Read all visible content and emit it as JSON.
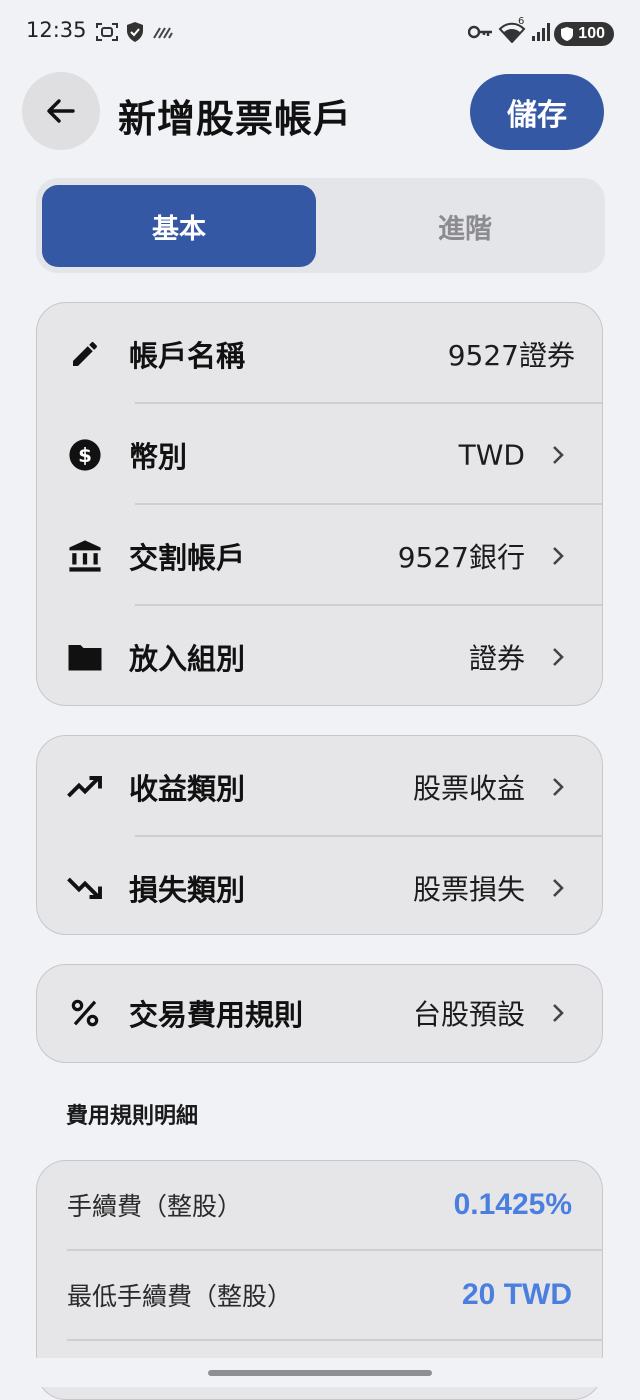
{
  "status_bar": {
    "time": "12:35",
    "battery": "100",
    "network_badge": "6"
  },
  "header": {
    "title": "新增股票帳戶",
    "save_label": "儲存"
  },
  "tabs": [
    {
      "label": "基本",
      "active": true
    },
    {
      "label": "進階",
      "active": false
    }
  ],
  "account_card": [
    {
      "icon": "pencil-icon",
      "label": "帳戶名稱",
      "value": "9527證券",
      "has_arrow": false
    },
    {
      "icon": "dollar-circle-icon",
      "label": "幣別",
      "value": "TWD",
      "has_arrow": true
    },
    {
      "icon": "bank-icon",
      "label": "交割帳戶",
      "value": "9527銀行",
      "has_arrow": true
    },
    {
      "icon": "folder-icon",
      "label": "放入組別",
      "value": "證券",
      "has_arrow": true
    }
  ],
  "category_card": [
    {
      "icon": "trending-up-icon",
      "label": "收益類別",
      "value": "股票收益",
      "has_arrow": true
    },
    {
      "icon": "trending-down-icon",
      "label": "損失類別",
      "value": "股票損失",
      "has_arrow": true
    }
  ],
  "fee_card": [
    {
      "icon": "percent-icon",
      "label": "交易費用規則",
      "value": "台股預設",
      "has_arrow": true
    }
  ],
  "fee_details": {
    "title": "費用規則明細",
    "rows": [
      {
        "label": "手續費（整股）",
        "value": "0.1425%"
      },
      {
        "label": "最低手續費（整股）",
        "value": "20 TWD"
      }
    ]
  },
  "colors": {
    "primary": "#3558a5",
    "accent_value": "#4a7fe0",
    "background": "#f1f2f6",
    "card": "#e6e6e9"
  }
}
